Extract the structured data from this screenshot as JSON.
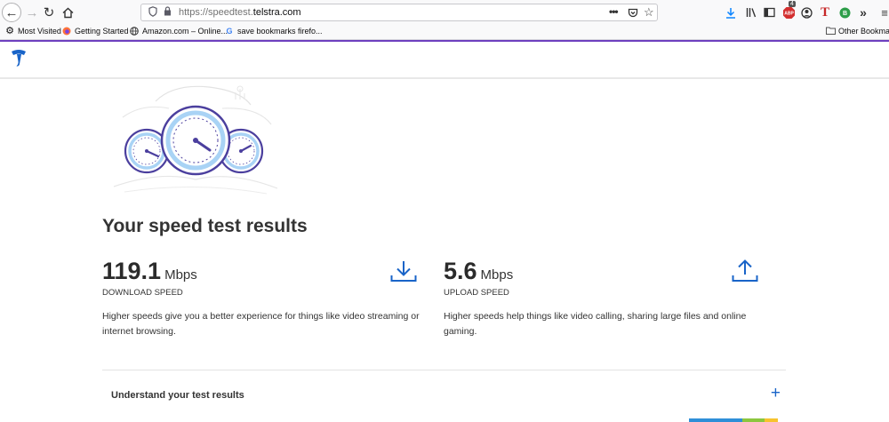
{
  "browser": {
    "url_prefix": "https://speedtest.",
    "url_domain": "telstra.com",
    "badge_count": "4"
  },
  "bookmarks": [
    {
      "label": "Most Visited",
      "icon": "gear-icon"
    },
    {
      "label": "Getting Started",
      "icon": "firefox-icon"
    },
    {
      "label": "Amazon.com – Online...",
      "icon": "globe-icon"
    },
    {
      "label": "save bookmarks firefo...",
      "icon": "google-icon"
    }
  ],
  "other_bookmarks": "Other Bookmarks",
  "results": {
    "title": "Your speed test results",
    "download": {
      "value": "119.1",
      "unit": "Mbps",
      "label": "DOWNLOAD SPEED",
      "description": "Higher speeds give you a better experience for things like video streaming or internet browsing."
    },
    "upload": {
      "value": "5.6",
      "unit": "Mbps",
      "label": "UPLOAD SPEED",
      "description": "Higher speeds help things like video calling, sharing large files and online gaming."
    }
  },
  "accordion": {
    "title": "Understand your test results",
    "toggle": "+"
  },
  "colors": {
    "accent_purple": "#6d3fbf",
    "telstra_blue": "#1964c8",
    "gauge_purple": "#4b3f9e",
    "gauge_light_blue": "#a9d3f5"
  }
}
